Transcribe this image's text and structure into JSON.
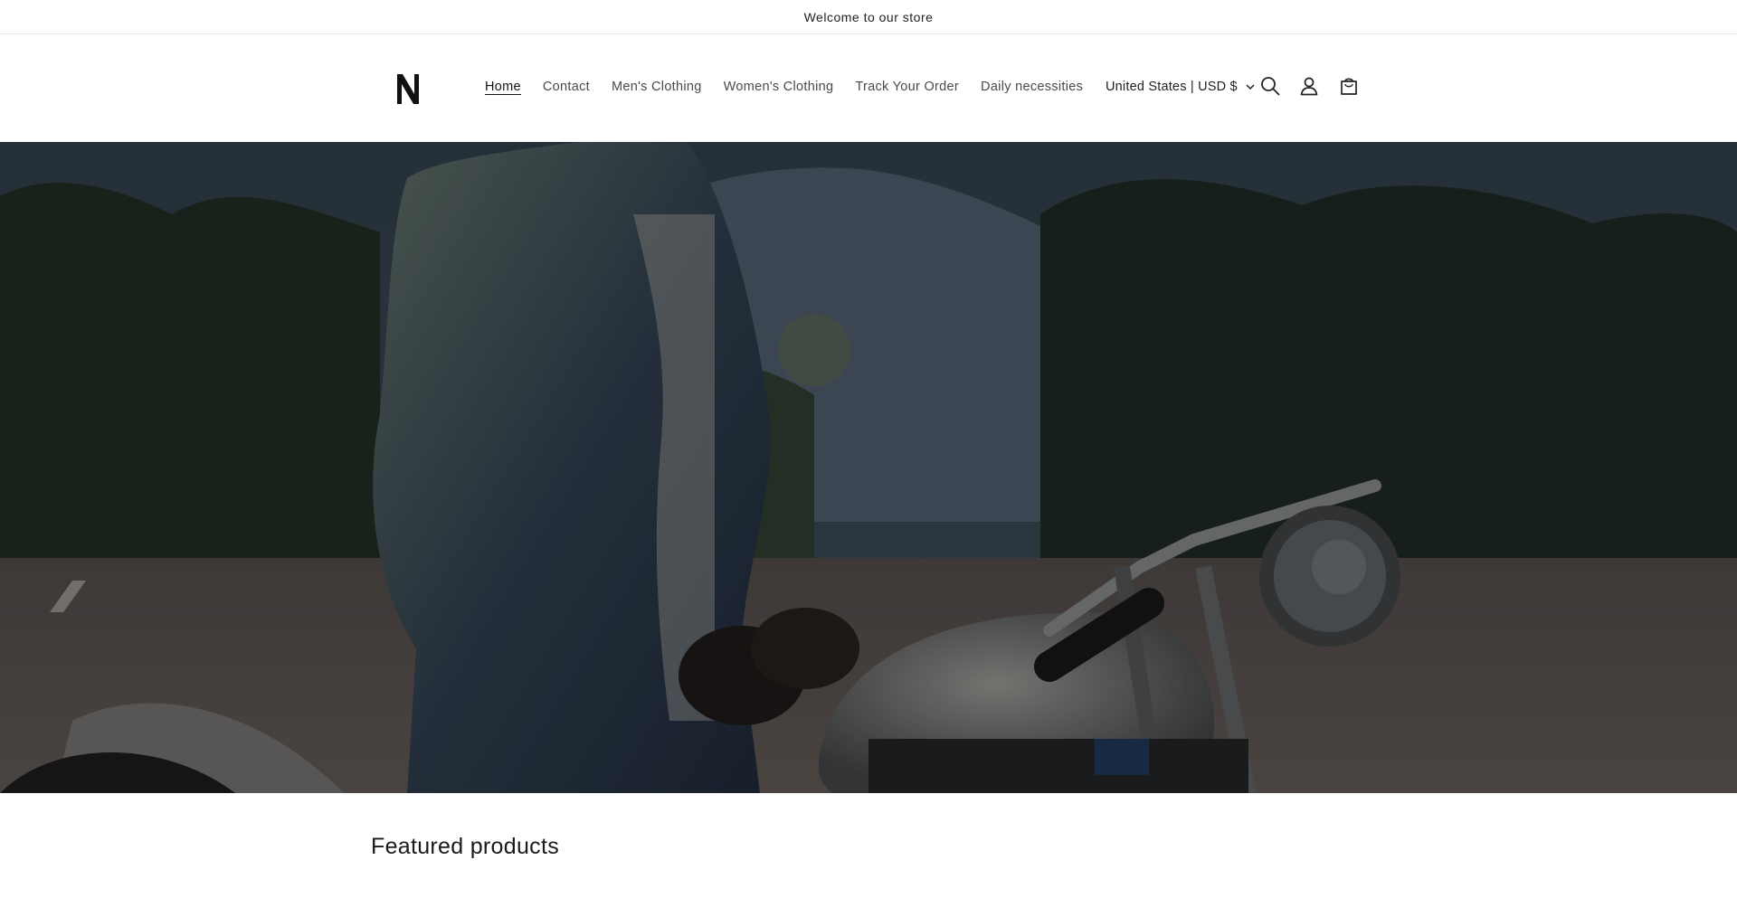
{
  "announcement": {
    "text": "Welcome to our store"
  },
  "header": {
    "logo_alt": "N",
    "nav": [
      {
        "label": "Home",
        "active": true
      },
      {
        "label": "Contact",
        "active": false
      },
      {
        "label": "Men's Clothing",
        "active": false
      },
      {
        "label": "Women's Clothing",
        "active": false
      },
      {
        "label": "Track Your Order",
        "active": false
      },
      {
        "label": "Daily necessities",
        "active": false
      }
    ],
    "currency": "United States | USD $",
    "icons": [
      "search-icon",
      "account-icon",
      "cart-icon"
    ]
  },
  "hero": {
    "image": "man-in-denim-jacket-on-motorcycle"
  },
  "featured": {
    "title": "Featured products"
  },
  "colors": {
    "text": "#121212",
    "muted": "#4a4a4a",
    "border": "#e6e6e6",
    "background": "#ffffff"
  }
}
